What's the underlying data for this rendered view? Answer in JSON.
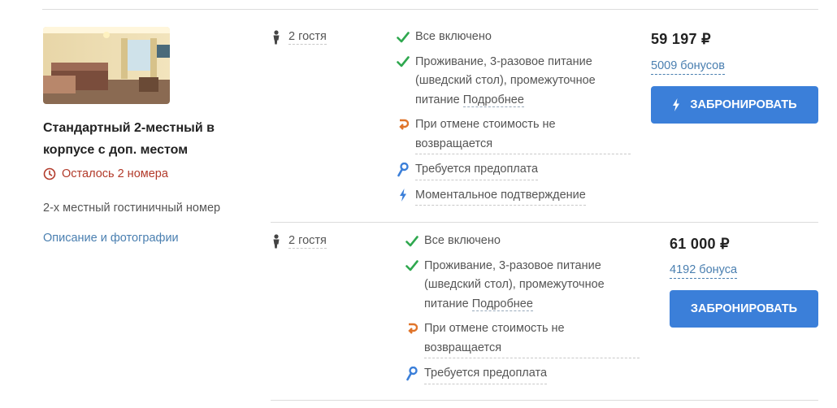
{
  "room": {
    "title": "Стандартный 2-местный в корпусе с доп. местом",
    "rooms_left": "Осталось 2 номера",
    "type": "2-х местный гостиничный номер",
    "description_link": "Описание и фотографии",
    "photo_icon": "hotel-room-photo"
  },
  "rates": [
    {
      "guests": "2 гостя",
      "conditions": {
        "all_inclusive": "Все включено",
        "meals_line1": "Проживание, 3-разовое питание",
        "meals_line2": "(шведский стол), промежуточное",
        "meals_line3": "питание",
        "meals_more": "Подробнее",
        "cancel_line1": "При отмене стоимость не",
        "cancel_line2": "возвращается",
        "prepay": "Требуется предоплата",
        "instant": "Моментальное подтверждение"
      },
      "price": "59 197 ₽",
      "bonus": "5009 бонусов",
      "book_label": "Забронировать"
    },
    {
      "guests": "2 гостя",
      "conditions": {
        "all_inclusive": "Все включено",
        "meals_line1": "Проживание, 3-разовое питание",
        "meals_line2": "(шведский стол), промежуточное",
        "meals_line3": "питание",
        "meals_more": "Подробнее",
        "cancel_line1": "При отмене стоимость не",
        "cancel_line2": "возвращается",
        "prepay": "Требуется предоплата"
      },
      "price": "61 000 ₽",
      "bonus": "4192 бонуса",
      "book_label": "Забронировать"
    }
  ],
  "colors": {
    "button": "#3b7fd9",
    "link": "#4a7fb0",
    "check": "#2fa84f",
    "warning_text": "#b23a2a",
    "cancel_icon": "#e0742a",
    "key_icon": "#3b7fd9"
  }
}
